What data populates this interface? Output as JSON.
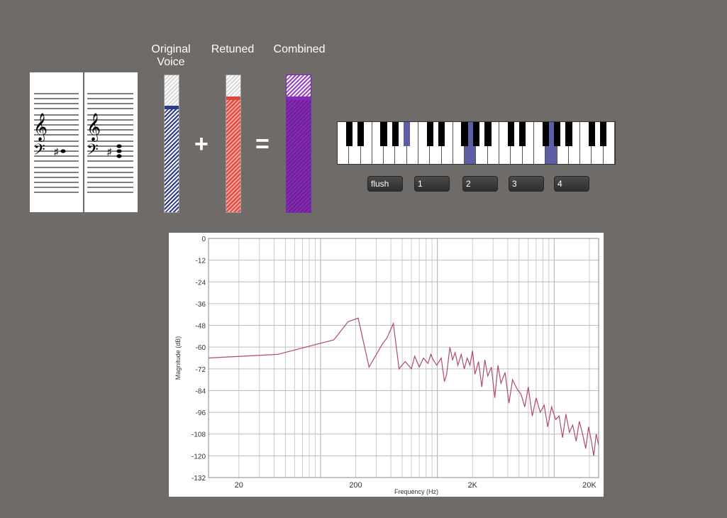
{
  "meters": {
    "original_label": "Original Voice",
    "retuned_label": "Retuned",
    "combined_label": "Combined",
    "original_level": 0.76,
    "retuned_level": 0.83,
    "combined_level": 0.83,
    "colors": {
      "original": "#2e3a8c",
      "retuned": "#e0463a",
      "combined": "#8a2bb5"
    }
  },
  "operators": {
    "plus": "+",
    "equals": "="
  },
  "keyboard": {
    "highlight_color": "#5e5ea6",
    "highlighted_white_keys": [
      11,
      18
    ],
    "highlighted_black_keys": [
      4
    ]
  },
  "buttons": [
    "flush",
    "1",
    "2",
    "3",
    "4"
  ],
  "chart_data": {
    "type": "line",
    "xlabel": "Frequency (Hz)",
    "ylabel": "Magnitude (dB)",
    "x_scale": "log",
    "xlim": [
      11,
      24000
    ],
    "ylim": [
      -132,
      0
    ],
    "x_ticks": [
      {
        "value": 20,
        "label": "20"
      },
      {
        "value": 200,
        "label": "200"
      },
      {
        "value": 2000,
        "label": "2K"
      },
      {
        "value": 20000,
        "label": "20K"
      }
    ],
    "y_ticks": [
      0,
      -12,
      -24,
      -36,
      -48,
      -60,
      -72,
      -84,
      -96,
      -108,
      -120,
      -132
    ],
    "grid": true,
    "line_color": "#b04a6e",
    "series": [
      {
        "x": [
          11,
          43,
          86,
          130,
          172,
          210,
          260,
          340,
          370,
          420,
          470,
          530,
          600,
          640,
          700,
          760,
          830,
          880,
          920,
          990,
          1080,
          1150,
          1200,
          1280,
          1350,
          1420,
          1500,
          1600,
          1700,
          1800,
          1900,
          2000,
          2100,
          2250,
          2400,
          2550,
          2700,
          2900,
          3100,
          3300,
          3500,
          3800,
          4100,
          4400,
          4800,
          5200,
          5600,
          6000,
          6500,
          7000,
          7600,
          8200,
          8800,
          9500,
          10300,
          11000,
          11800,
          12600,
          13500,
          14400,
          15400,
          16400,
          17500,
          18600,
          19700,
          20800,
          21800,
          22900,
          24000
        ],
        "values": [
          -66,
          -64,
          -59,
          -56,
          -46,
          -44,
          -71,
          -58,
          -55,
          -47,
          -72,
          -68,
          -72,
          -65,
          -71,
          -66,
          -69,
          -64,
          -67,
          -70,
          -66,
          -79,
          -75,
          -60,
          -67,
          -63,
          -70,
          -64,
          -72,
          -66,
          -70,
          -62,
          -75,
          -68,
          -82,
          -67,
          -76,
          -71,
          -88,
          -70,
          -80,
          -74,
          -91,
          -78,
          -83,
          -86,
          -93,
          -82,
          -98,
          -88,
          -96,
          -92,
          -104,
          -93,
          -100,
          -98,
          -110,
          -97,
          -107,
          -103,
          -112,
          -101,
          -108,
          -116,
          -104,
          -112,
          -120,
          -108,
          -114
        ]
      }
    ]
  }
}
